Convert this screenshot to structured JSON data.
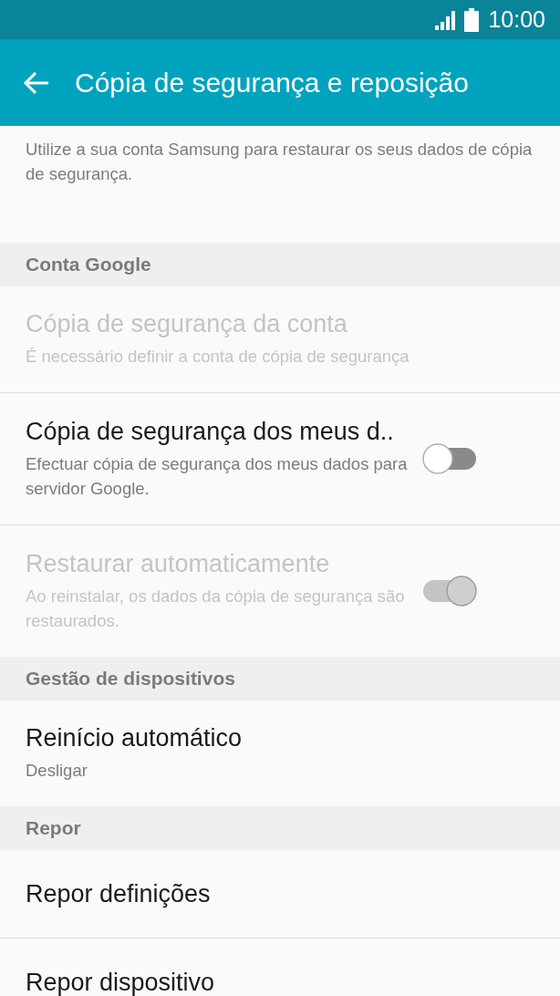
{
  "status_bar": {
    "time": "10:00"
  },
  "app_bar": {
    "title": "Cópia de segurança e reposição"
  },
  "sections": [
    {
      "items": [
        {
          "subtitle": "Utilize a sua conta Samsung para restaurar os seus dados de cópia de segurança.",
          "disabled": false
        }
      ]
    },
    {
      "header": "Conta Google",
      "items": [
        {
          "title": "Cópia de segurança da conta",
          "subtitle": "É necessário definir a conta de cópia de segurança",
          "disabled": true
        },
        {
          "title": "Cópia de segurança dos meus d..",
          "subtitle": "Efectuar cópia de segurança dos meus dados para servidor Google.",
          "disabled": false,
          "toggle": {
            "on": false
          }
        },
        {
          "title": "Restaurar automaticamente",
          "subtitle": "Ao reinstalar, os dados da cópia de segurança são restaurados.",
          "disabled": true,
          "toggle": {
            "on": true
          }
        }
      ]
    },
    {
      "header": "Gestão de dispositivos",
      "items": [
        {
          "title": "Reinício automático",
          "subtitle": "Desligar",
          "disabled": false
        }
      ]
    },
    {
      "header": "Repor",
      "items": [
        {
          "title": "Repor definições",
          "disabled": false
        },
        {
          "title": "Repor dispositivo",
          "disabled": false
        }
      ]
    }
  ]
}
